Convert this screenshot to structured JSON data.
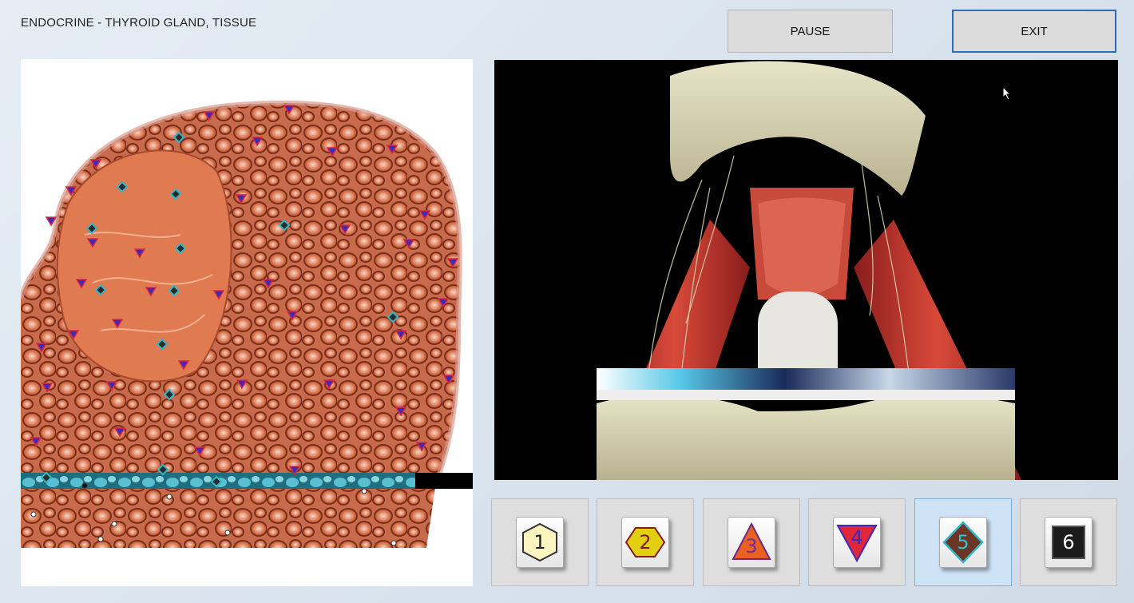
{
  "header": {
    "title": "ENDOCRINE - THYROID GLAND, TISSUE",
    "pause_label": "PAUSE",
    "exit_label": "EXIT"
  },
  "left_view": {
    "icon": "thyroid-tissue-icon"
  },
  "right_view": {
    "icon": "neck-anatomy-icon"
  },
  "modes": [
    {
      "label": "1",
      "shape": "hexagon",
      "fill": "#fbf5c0",
      "stroke": "#333333",
      "text_color": "#222222",
      "active": false
    },
    {
      "label": "2",
      "shape": "hexagon",
      "fill": "#e2cf10",
      "stroke": "#8a1a1a",
      "text_color": "#7a1a1a",
      "active": false
    },
    {
      "label": "3",
      "shape": "triangle-up",
      "fill": "#e8611f",
      "stroke": "#6a2a8a",
      "text_color": "#7a2aa0",
      "active": false
    },
    {
      "label": "4",
      "shape": "triangle-down",
      "fill": "#e0263a",
      "stroke": "#3a2ac0",
      "text_color": "#3a2ac0",
      "active": false
    },
    {
      "label": "5",
      "shape": "diamond",
      "fill": "#6b3624",
      "stroke": "#30b8c8",
      "text_color": "#30c0d0",
      "active": true
    },
    {
      "label": "6",
      "shape": "square",
      "fill": "#1c1c1c",
      "stroke": "#555555",
      "text_color": "#ffffff",
      "active": false
    }
  ]
}
